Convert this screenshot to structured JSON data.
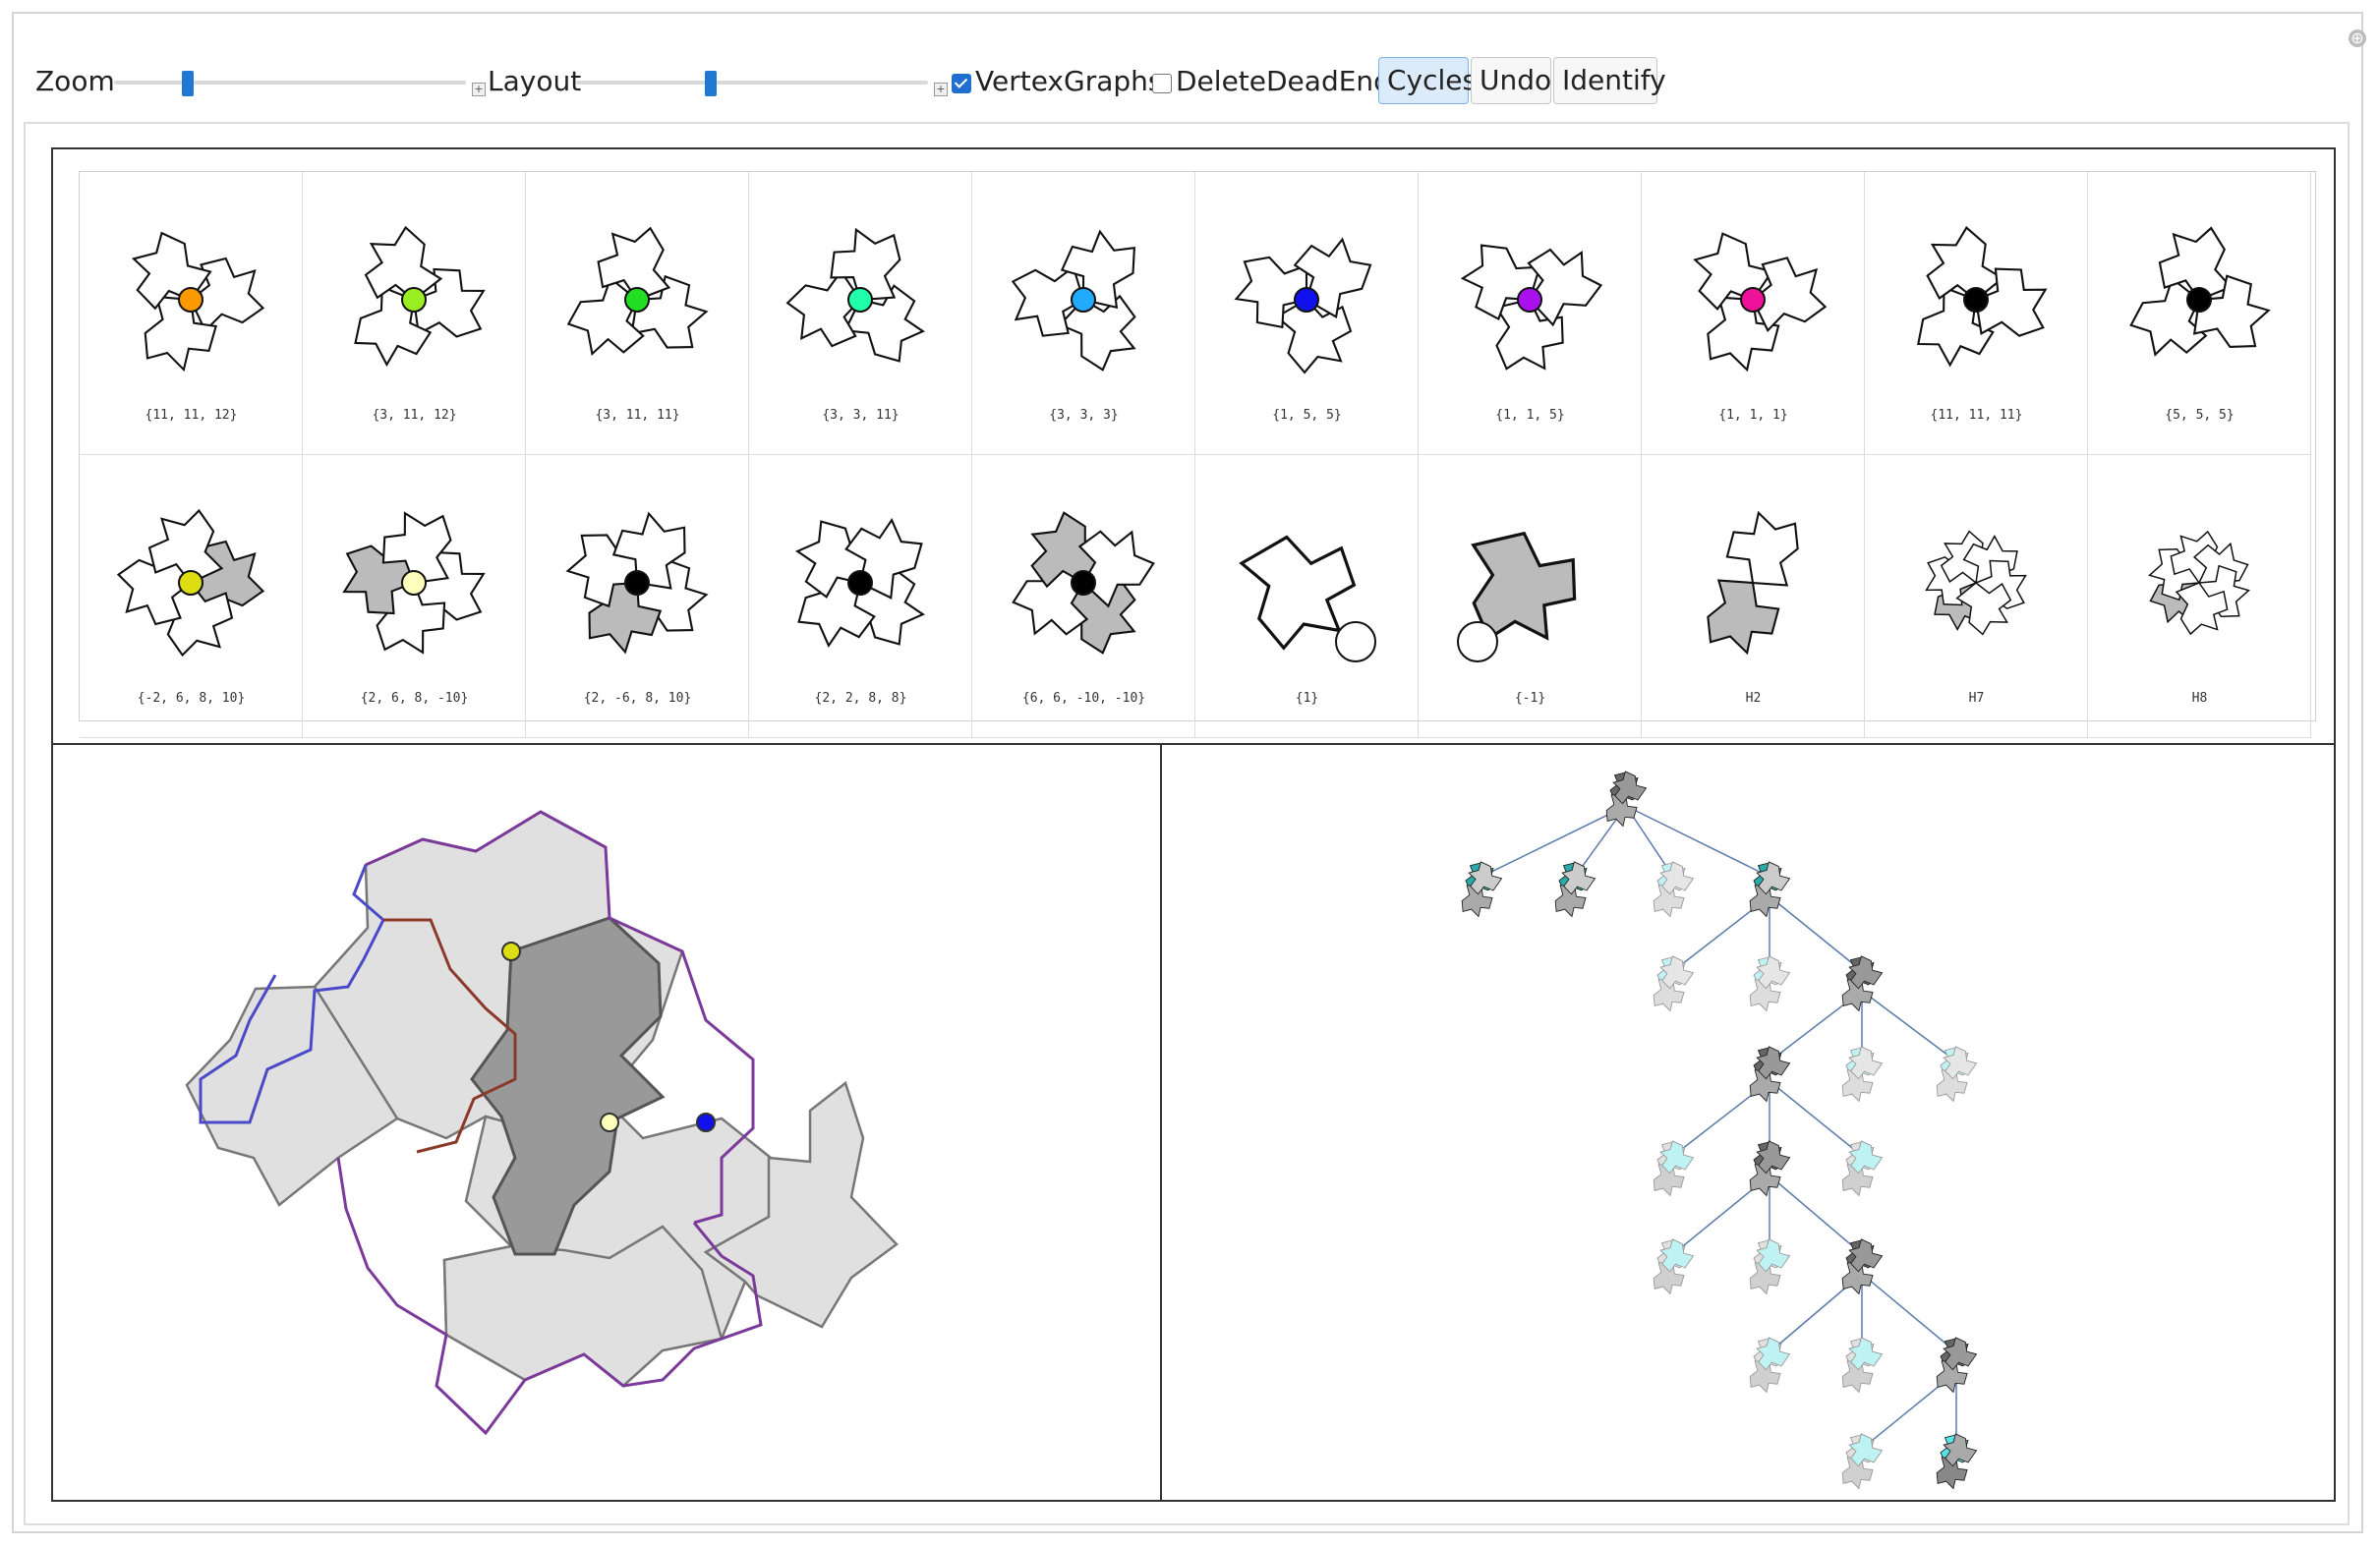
{
  "toolbar": {
    "zoom_label": "Zoom",
    "zoom_value": 0.2,
    "layout_label": "Layout",
    "layout_value": 0.38,
    "vertexgraphs_label": "VertexGraphs",
    "vertexgraphs_checked": true,
    "deletedeadends_label": "DeleteDeadEnds",
    "deletedeadends_checked": false,
    "cycles_label": "Cycles",
    "undo_label": "Undo",
    "identify_label": "Identify"
  },
  "gallery": {
    "row1": [
      {
        "label": "{11, 11, 12}",
        "dot": "#ff9900"
      },
      {
        "label": "{3, 11, 12}",
        "dot": "#99ee22"
      },
      {
        "label": "{3, 11, 11}",
        "dot": "#22dd22"
      },
      {
        "label": "{3, 3, 11}",
        "dot": "#22ffaa"
      },
      {
        "label": "{3, 3, 3}",
        "dot": "#22aaff"
      },
      {
        "label": "{1, 5, 5}",
        "dot": "#1111ee"
      },
      {
        "label": "{1, 1, 5}",
        "dot": "#aa11ee"
      },
      {
        "label": "{1, 1, 1}",
        "dot": "#ee1199"
      },
      {
        "label": "{11, 11, 11}",
        "dot": "#000000"
      },
      {
        "label": "{5, 5, 5}",
        "dot": "#000000"
      }
    ],
    "row2": [
      {
        "label": "{-2, 6, 8, 10}",
        "dot": "#dddd11"
      },
      {
        "label": "{2, 6, 8, -10}",
        "dot": "#ffffbb"
      },
      {
        "label": "{2, -6, 8, 10}",
        "dot": "#000000"
      },
      {
        "label": "{2, 2, 8, 8}",
        "dot": "#000000"
      },
      {
        "label": "{6, 6, -10, -10}",
        "dot": "#000000"
      },
      {
        "label": "{1}",
        "dot": "#ffffff"
      },
      {
        "label": "{-1}",
        "dot": "#ffffff"
      },
      {
        "label": "H2",
        "dot": ""
      },
      {
        "label": "H7",
        "dot": ""
      },
      {
        "label": "H8",
        "dot": ""
      }
    ]
  },
  "colors": {
    "tile_fill": "#e0e0e0",
    "tile_dark": "#999999",
    "purple_edge": "#7b3a9a",
    "blue_edge": "#4a4ac8",
    "brown_edge": "#8b3a2a",
    "cyan": "#55e6e6",
    "teal": "#2aaaaa",
    "tree_edge": "#5a7aaa"
  }
}
